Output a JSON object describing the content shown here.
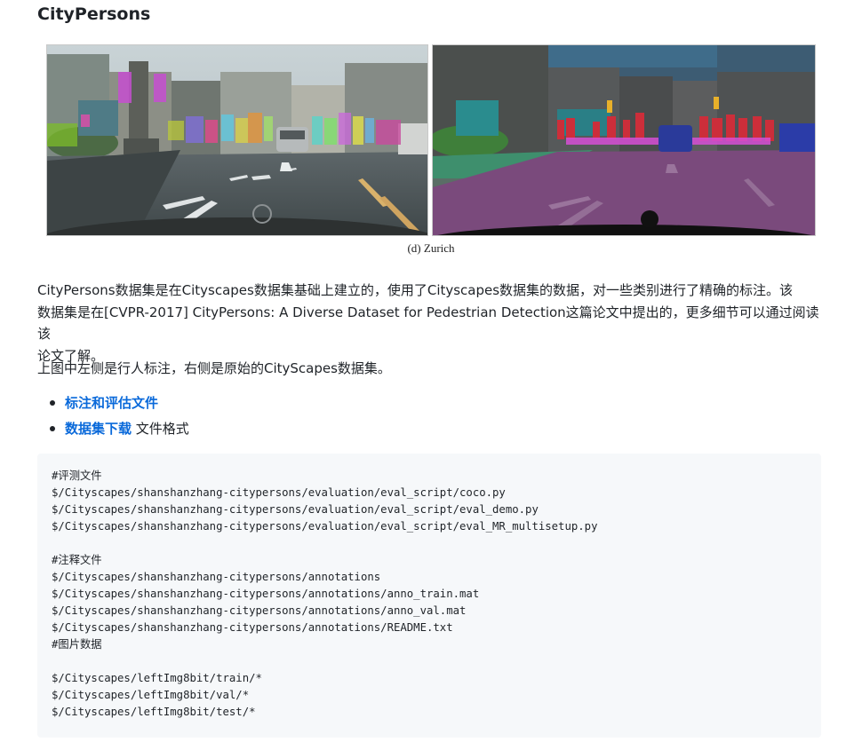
{
  "heading": "CityPersons",
  "figure": {
    "caption": "(d) Zurich"
  },
  "paragraphs": {
    "intro_1": "CityPersons数据集是在Cityscapes数据集基础上建立的，使用了Cityscapes数据集的数据，对一些类别进行了精确的标注。该",
    "intro_2": "数据集是在[CVPR-2017] CityPersons: A Diverse Dataset for Pedestrian Detection这篇论文中提出的，更多细节可以通过阅读该",
    "intro_3": "论文了解。",
    "note": "上图中左侧是行人标注，右侧是原始的CityScapes数据集。"
  },
  "links": {
    "annotation_eval": "标注和评估文件",
    "dataset_download": "数据集下载",
    "file_format": " 文件格式"
  },
  "code_lines": {
    "l01": "#评测文件",
    "l02": "$/Cityscapes/shanshanzhang-citypersons/evaluation/eval_script/coco.py",
    "l03": "$/Cityscapes/shanshanzhang-citypersons/evaluation/eval_script/eval_demo.py",
    "l04": "$/Cityscapes/shanshanzhang-citypersons/evaluation/eval_script/eval_MR_multisetup.py",
    "l05": "",
    "l06": "#注释文件",
    "l07": "$/Cityscapes/shanshanzhang-citypersons/annotations",
    "l08": "$/Cityscapes/shanshanzhang-citypersons/annotations/anno_train.mat",
    "l09": "$/Cityscapes/shanshanzhang-citypersons/annotations/anno_val.mat",
    "l10": "$/Cityscapes/shanshanzhang-citypersons/annotations/README.txt",
    "l11": "#图片数据",
    "l12": "",
    "l13": "$/Cityscapes/leftImg8bit/train/*",
    "l14": "$/Cityscapes/leftImg8bit/val/*",
    "l15": "$/Cityscapes/leftImg8bit/test/*"
  }
}
